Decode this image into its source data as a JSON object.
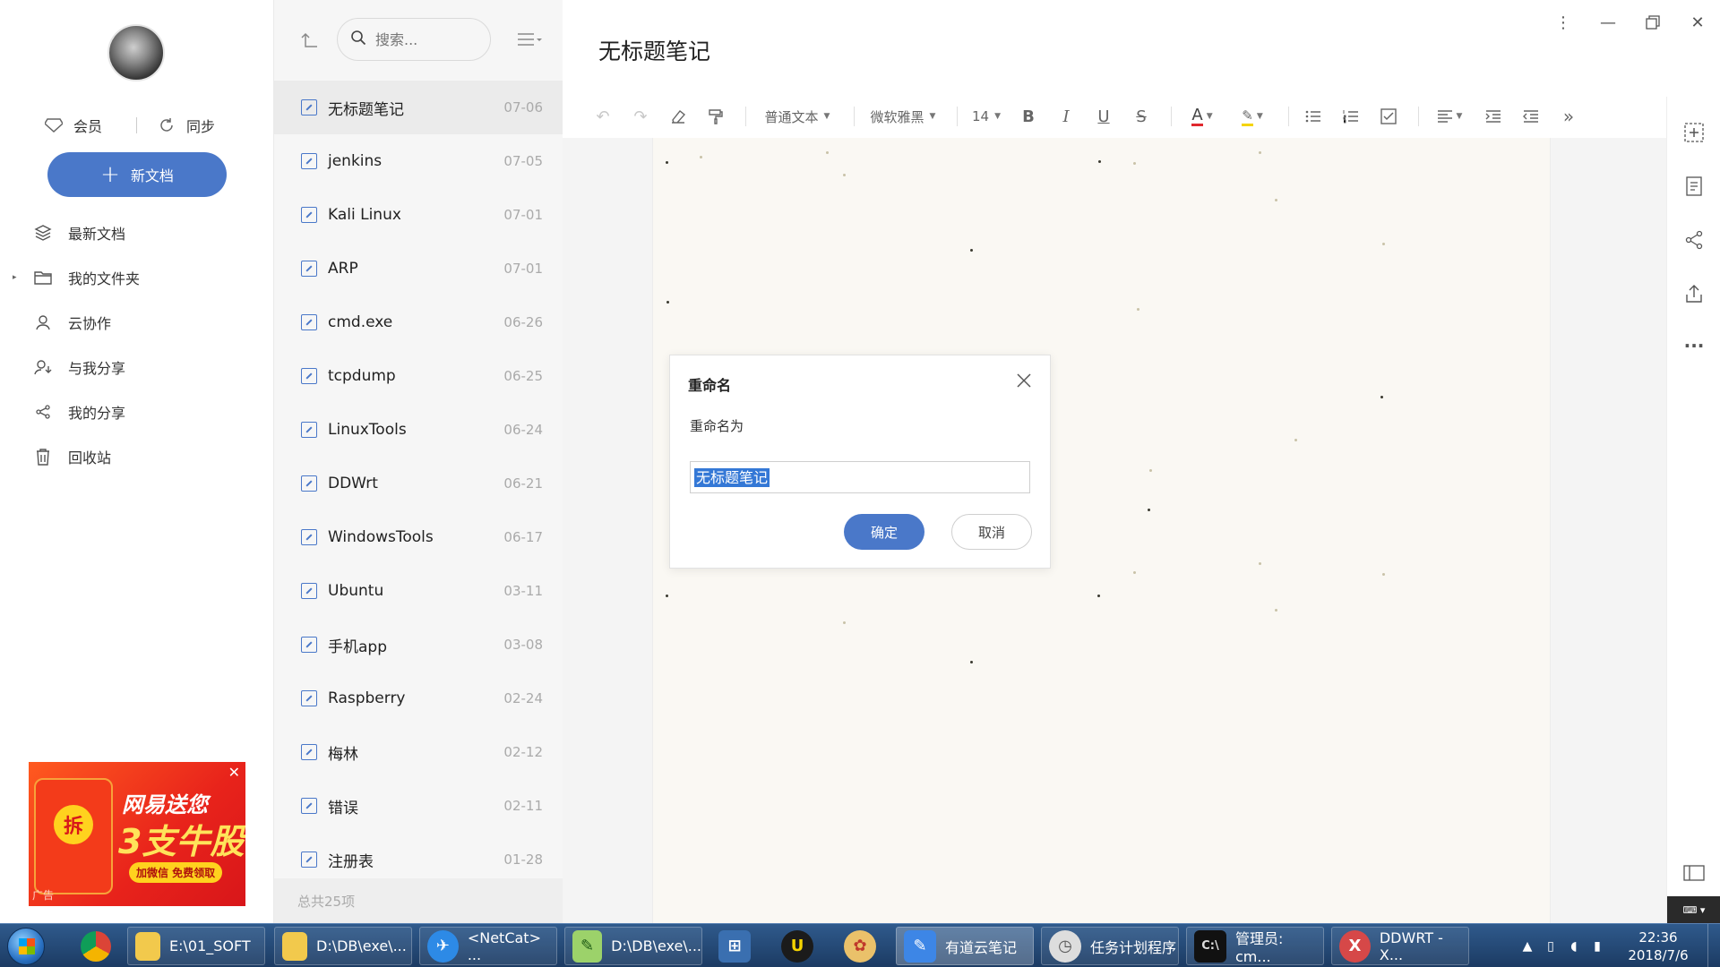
{
  "app": {
    "accent": "#4a78c9"
  },
  "sidebar": {
    "member_label": "会员",
    "sync_label": "同步",
    "new_doc_label": "新文档",
    "items": [
      {
        "label": "最新文档",
        "icon": "layers-icon"
      },
      {
        "label": "我的文件夹",
        "icon": "folder-icon"
      },
      {
        "label": "云协作",
        "icon": "user-icon"
      },
      {
        "label": "与我分享",
        "icon": "shared-with-me-icon"
      },
      {
        "label": "我的分享",
        "icon": "share-icon"
      },
      {
        "label": "回收站",
        "icon": "trash-icon"
      }
    ],
    "ad": {
      "line1": "网易送您",
      "line2": "3支牛股",
      "cta": "加微信 免费领取",
      "badge": "拆",
      "label": "广告"
    }
  },
  "notelist": {
    "search_placeholder": "搜索...",
    "notes": [
      {
        "title": "无标题笔记",
        "date": "07-06"
      },
      {
        "title": "jenkins",
        "date": "07-05"
      },
      {
        "title": "Kali Linux",
        "date": "07-01"
      },
      {
        "title": "ARP",
        "date": "07-01"
      },
      {
        "title": "cmd.exe",
        "date": "06-26"
      },
      {
        "title": "tcpdump",
        "date": "06-25"
      },
      {
        "title": "LinuxTools",
        "date": "06-24"
      },
      {
        "title": "DDWrt",
        "date": "06-21"
      },
      {
        "title": "WindowsTools",
        "date": "06-17"
      },
      {
        "title": "Ubuntu",
        "date": "03-11"
      },
      {
        "title": "手机app",
        "date": "03-08"
      },
      {
        "title": "Raspberry",
        "date": "02-24"
      },
      {
        "title": "梅林",
        "date": "02-12"
      },
      {
        "title": "错误",
        "date": "02-11"
      },
      {
        "title": "注册表",
        "date": "01-28"
      }
    ],
    "footer": "总共25项"
  },
  "editor": {
    "title": "无标题笔记",
    "toolbar": {
      "style": "普通文本",
      "font": "微软雅黑",
      "size": "14"
    }
  },
  "dialog": {
    "title": "重命名",
    "label": "重命名为",
    "value": "无标题笔记",
    "ok": "确定",
    "cancel": "取消"
  },
  "taskbar": {
    "apps": [
      {
        "label": "E:\\01_SOFT",
        "icon": "folder-icon"
      },
      {
        "label": "D:\\DB\\exe\\...",
        "icon": "folder-icon"
      },
      {
        "label": "<NetCat> ...",
        "icon": "netcat-icon"
      },
      {
        "label": "D:\\DB\\exe\\...",
        "icon": "notepad-icon"
      },
      {
        "label": "有道云笔记",
        "icon": "youdao-note-icon"
      },
      {
        "label": "任务计划程序",
        "icon": "clock-icon"
      },
      {
        "label": "管理员: cm...",
        "icon": "cmd-icon"
      },
      {
        "label": "DDWRT - X...",
        "icon": "xshell-icon"
      }
    ],
    "time": "22:36",
    "date": "2018/7/6"
  }
}
